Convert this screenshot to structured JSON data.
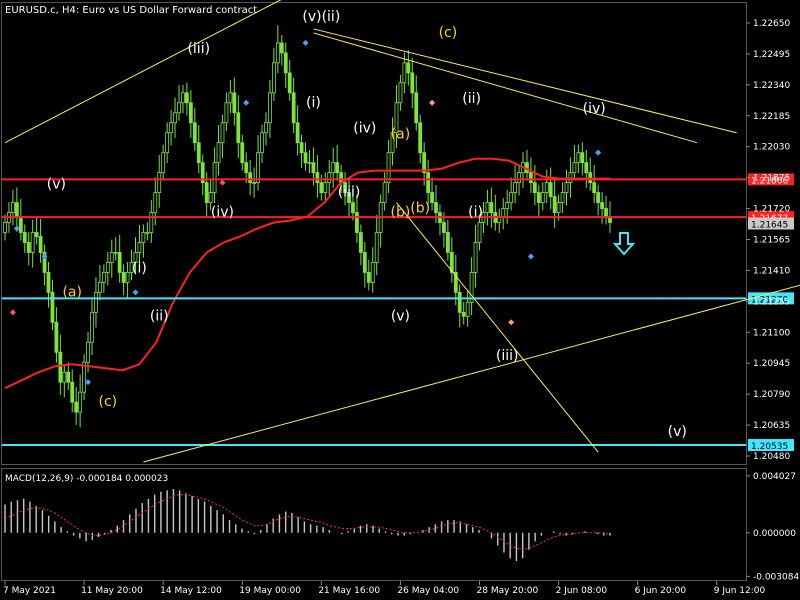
{
  "header": {
    "title": "EURUSD.c, H4:  Euro vs US Dollar Forward contract"
  },
  "colors": {
    "background": "#000000",
    "bull_candle": "#7ee33a",
    "bear_candle": "#7ee33a",
    "ma_line": "#ff2020",
    "hline_red": "#ff2020",
    "hline_cyan": "#40e8ff",
    "trendline": "#ffee55",
    "macd_hist": "#c8c8c8",
    "macd_signal": "#ff3030",
    "axis_text": "#ffffff",
    "grid": "#444444",
    "label_red_bg": "#ff2020",
    "label_cyan_bg": "#40e8ff",
    "label_gray_bg": "#c8c8c8"
  },
  "chart_data": [
    {
      "type": "candlestick",
      "symbol": "EURUSD.c",
      "timeframe": "H4",
      "ylim": [
        1.2045,
        1.2274
      ],
      "y_ticks": [
        1.2265,
        1.22495,
        1.2234,
        1.22185,
        1.2203,
        1.21875,
        1.2172,
        1.21565,
        1.2141,
        1.21255,
        1.211,
        1.20945,
        1.2079,
        1.20635,
        1.2048
      ],
      "y_tick_labels": [
        "1.22650",
        "1.22495",
        "1.22340",
        "1.22185",
        "1.22030",
        "1.21875",
        "1.21720",
        "1.21565",
        "1.21410",
        "1.21255",
        "1.21100",
        "1.20945",
        "1.20790",
        "1.20635",
        "1.20480"
      ],
      "x_tick_labels": [
        "7 May 2021",
        "11 May 20:00",
        "14 May 12:00",
        "19 May 00:00",
        "21 May 16:00",
        "26 May 04:00",
        "28 May 20:00",
        "2 Jun 08:00",
        "6 Jun 20:00",
        "9 Jun 12:00"
      ],
      "x_tick_index": [
        0,
        20,
        40,
        60,
        80,
        100,
        120,
        140,
        160,
        180
      ],
      "candles_close": [
        1.2165,
        1.217,
        1.2175,
        1.2168,
        1.216,
        1.2155,
        1.215,
        1.216,
        1.2158,
        1.215,
        1.214,
        1.213,
        1.2115,
        1.21,
        1.2085,
        1.209,
        1.2085,
        1.2075,
        1.207,
        1.208,
        1.2095,
        1.2105,
        1.212,
        1.213,
        1.2135,
        1.214,
        1.2145,
        1.215,
        1.215,
        1.214,
        1.2135,
        1.214,
        1.2145,
        1.215,
        1.2155,
        1.216,
        1.216,
        1.217,
        1.218,
        1.219,
        1.22,
        1.221,
        1.2215,
        1.222,
        1.2225,
        1.223,
        1.2225,
        1.2215,
        1.2205,
        1.2195,
        1.2185,
        1.2175,
        1.218,
        1.2195,
        1.2205,
        1.2215,
        1.2225,
        1.223,
        1.222,
        1.2205,
        1.2195,
        1.219,
        1.2185,
        1.2185,
        1.22,
        1.221,
        1.2215,
        1.223,
        1.2245,
        1.2255,
        1.225,
        1.224,
        1.223,
        1.2215,
        1.2205,
        1.22,
        1.2195,
        1.2195,
        1.219,
        1.2185,
        1.218,
        1.2185,
        1.219,
        1.2195,
        1.219,
        1.2185,
        1.218,
        1.2175,
        1.217,
        1.216,
        1.215,
        1.214,
        1.2135,
        1.2145,
        1.216,
        1.2175,
        1.2185,
        1.22,
        1.221,
        1.2225,
        1.2235,
        1.2245,
        1.224,
        1.223,
        1.2215,
        1.22,
        1.219,
        1.218,
        1.2175,
        1.217,
        1.2165,
        1.216,
        1.215,
        1.214,
        1.213,
        1.212,
        1.2118,
        1.2125,
        1.214,
        1.2155,
        1.2165,
        1.217,
        1.2175,
        1.217,
        1.2165,
        1.2168,
        1.2172,
        1.2175,
        1.218,
        1.2185,
        1.219,
        1.2195,
        1.219,
        1.2185,
        1.218,
        1.2175,
        1.218,
        1.2185,
        1.2178,
        1.217,
        1.2175,
        1.218,
        1.2185,
        1.219,
        1.2195,
        1.22,
        1.2195,
        1.219,
        1.2185,
        1.218,
        1.2175,
        1.2172,
        1.2168,
        1.2165
      ],
      "ma_values": [
        1.2082,
        1.2086,
        1.209,
        1.2093,
        1.2094,
        1.2093,
        1.2092,
        1.2091,
        1.2094,
        1.2105,
        1.2125,
        1.214,
        1.215,
        1.2155,
        1.2158,
        1.2162,
        1.2165,
        1.2166,
        1.2168,
        1.2175,
        1.2185,
        1.219,
        1.2191,
        1.2191,
        1.2191,
        1.2191,
        1.2192,
        1.2195,
        1.2197,
        1.2197,
        1.2196,
        1.2192,
        1.2188,
        1.2187,
        1.2187,
        1.2187,
        1.2187
      ],
      "horizontal_lines": [
        {
          "value": 1.21866,
          "label": "1.21866",
          "color": "red"
        },
        {
          "value": 1.21677,
          "label": "1.21677",
          "color": "red"
        },
        {
          "value": 1.21645,
          "label": "1.21645",
          "color": "gray"
        },
        {
          "value": 1.2127,
          "label": "1.21270",
          "color": "cyan"
        },
        {
          "value": 1.20535,
          "label": "1.20535",
          "color": "cyan"
        }
      ],
      "wave_labels": [
        {
          "text": "(v)",
          "color": "white"
        },
        {
          "text": "(iii)",
          "color": "white"
        },
        {
          "text": "(v)(ii)",
          "color": "white"
        },
        {
          "text": "(c)",
          "color": "yellow"
        },
        {
          "text": "(ii)",
          "color": "white"
        },
        {
          "text": "(iv)",
          "color": "white"
        },
        {
          "text": "(i)",
          "color": "white"
        },
        {
          "text": "(iv)",
          "color": "white"
        },
        {
          "text": "(a)",
          "color": "yellow"
        },
        {
          "text": "(b)",
          "color": "yellow"
        },
        {
          "text": "(a)",
          "color": "yellow"
        },
        {
          "text": "(i)",
          "color": "white"
        },
        {
          "text": "(iv)",
          "color": "white"
        },
        {
          "text": "(ii)",
          "color": "white"
        },
        {
          "text": "(iii)",
          "color": "white"
        },
        {
          "text": "(b)",
          "color": "yellow"
        },
        {
          "text": "(i)",
          "color": "white"
        },
        {
          "text": "(v)",
          "color": "white"
        },
        {
          "text": "(iii)",
          "color": "white"
        },
        {
          "text": "(c)",
          "color": "yellow"
        },
        {
          "text": "(v)",
          "color": "white"
        }
      ]
    },
    {
      "type": "bar",
      "title": "MACD(12,26,9) -0.000184 0.000023",
      "ylim": [
        -0.0032,
        0.0043
      ],
      "y_ticks": [
        0.004027,
        0.0,
        -0.003084
      ],
      "y_tick_labels": [
        "0.004027",
        "0.000000",
        "-0.003084"
      ],
      "histogram": [
        0.002,
        0.0022,
        0.0023,
        0.0024,
        0.0022,
        0.0019,
        0.0016,
        0.0012,
        0.0008,
        0.0004,
        0.0001,
        -0.0002,
        -0.0004,
        -0.0006,
        -0.0005,
        -0.0003,
        -0.0001,
        0.0002,
        0.0005,
        0.0009,
        0.0013,
        0.0017,
        0.0021,
        0.0024,
        0.0027,
        0.0029,
        0.003,
        0.0031,
        0.003,
        0.0028,
        0.0026,
        0.0024,
        0.0022,
        0.0019,
        0.0016,
        0.0013,
        0.0009,
        0.0006,
        0.0003,
        0.0001,
        -0.0001,
        0.0002,
        0.0006,
        0.001,
        0.0013,
        0.0015,
        0.0014,
        0.0011,
        0.0008,
        0.0006,
        0.0005,
        0.0004,
        0.0002,
        0.0,
        -0.0001,
        0.0001,
        0.0003,
        0.0005,
        0.0006,
        0.0005,
        0.0003,
        0.0001,
        -0.0001,
        -0.0002,
        -0.0002,
        -0.0001,
        0.0,
        0.0002,
        0.0004,
        0.0006,
        0.0008,
        0.0009,
        0.0009,
        0.0008,
        0.0006,
        0.0004,
        0.0002,
        0.0,
        -0.0004,
        -0.0009,
        -0.0014,
        -0.0018,
        -0.002,
        -0.0018,
        -0.0012,
        -0.0006,
        -0.0002,
        0.0,
        0.0001,
        -0.0001,
        -0.0002,
        -0.0001,
        0.0,
        0.0001,
        0.0,
        -0.0001,
        -0.0002,
        -0.0002
      ],
      "signal": [
        0.001,
        0.0012,
        0.0014,
        0.0016,
        0.0017,
        0.0018,
        0.0017,
        0.0016,
        0.0014,
        0.0011,
        0.0008,
        0.0005,
        0.0002,
        0.0,
        -0.0002,
        -0.0002,
        -0.0001,
        0.0,
        0.0002,
        0.0005,
        0.0008,
        0.0011,
        0.0014,
        0.0017,
        0.002,
        0.0022,
        0.0024,
        0.0026,
        0.0027,
        0.0027,
        0.0026,
        0.0025,
        0.0024,
        0.0022,
        0.002,
        0.0018,
        0.0015,
        0.0012,
        0.0009,
        0.0007,
        0.0005,
        0.0005,
        0.0006,
        0.0008,
        0.001,
        0.0011,
        0.0012,
        0.0011,
        0.001,
        0.0009,
        0.0008,
        0.0007,
        0.0005,
        0.0004,
        0.0003,
        0.0003,
        0.0003,
        0.0004,
        0.0004,
        0.0004,
        0.0004,
        0.0003,
        0.0002,
        0.0001,
        0.0,
        0.0,
        0.0,
        0.0001,
        0.0002,
        0.0003,
        0.0005,
        0.0006,
        0.0007,
        0.0007,
        0.0006,
        0.0005,
        0.0004,
        0.0002,
        0.0,
        -0.0003,
        -0.0006,
        -0.0009,
        -0.0011,
        -0.0012,
        -0.0011,
        -0.0009,
        -0.0007,
        -0.0005,
        -0.0003,
        -0.0002,
        -0.0001,
        -0.0001,
        0.0,
        0.0,
        0.0,
        0.0,
        0.0,
        -0.0001
      ]
    }
  ]
}
